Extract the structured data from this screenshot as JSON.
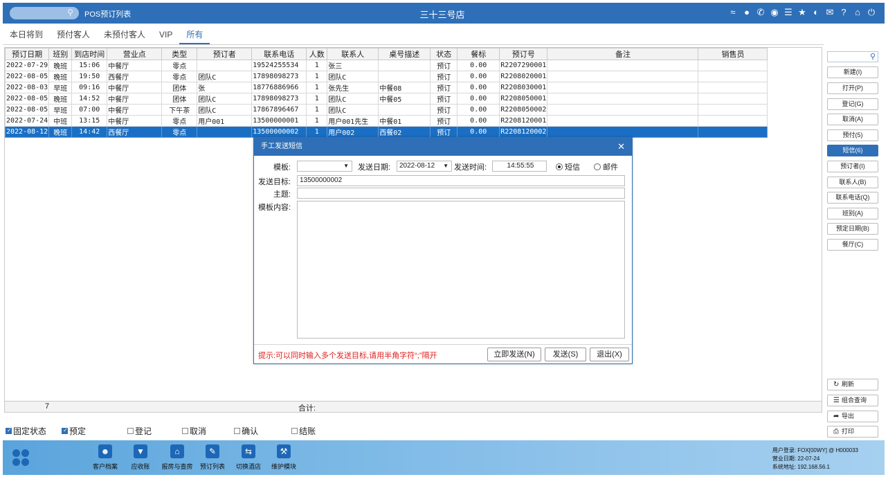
{
  "header": {
    "title": "POS预订列表",
    "store": "三十三号店",
    "icons": [
      "wifi-icon",
      "chat-icon",
      "phone-icon",
      "palette-icon",
      "menu-icon",
      "star-icon",
      "contrast-icon",
      "mail-icon",
      "help-icon",
      "home-icon",
      "power-icon"
    ]
  },
  "tabs": [
    {
      "label": "本日将到"
    },
    {
      "label": "预付客人"
    },
    {
      "label": "未预付客人"
    },
    {
      "label": "VIP"
    },
    {
      "label": "所有"
    }
  ],
  "grid": {
    "columns": [
      "预订日期",
      "班别",
      "到店时间",
      "营业点",
      "类型",
      "预订者",
      "联系电话",
      "人数",
      "联系人",
      "桌号描述",
      "状态",
      "餐标",
      "预订号",
      "备注",
      "销售员"
    ],
    "rows": [
      [
        "2022-07-29",
        "晚班",
        "15:06",
        "中餐厅",
        "零点",
        "",
        "19524255534",
        "1",
        "张三",
        "",
        "预订",
        "0.00",
        "R2207290001",
        "",
        ""
      ],
      [
        "2022-08-05",
        "晚班",
        "19:50",
        "西餐厅",
        "零点",
        "团队C",
        "17898098273",
        "1",
        "团队C",
        "",
        "预订",
        "0.00",
        "R2208020001",
        "",
        ""
      ],
      [
        "2022-08-03",
        "早班",
        "09:16",
        "中餐厅",
        "团体",
        "张",
        "18776886966",
        "1",
        "张先生",
        "中餐08",
        "预订",
        "0.00",
        "R2208030001",
        "",
        ""
      ],
      [
        "2022-08-05",
        "晚班",
        "14:52",
        "中餐厅",
        "团体",
        "团队C",
        "17898098273",
        "1",
        "团队C",
        "中餐05",
        "预订",
        "0.00",
        "R2208050001",
        "",
        ""
      ],
      [
        "2022-08-05",
        "早班",
        "07:00",
        "中餐厅",
        "下午茶",
        "团队C",
        "17867896467",
        "1",
        "团队C",
        "",
        "预订",
        "0.00",
        "R2208050002",
        "",
        ""
      ],
      [
        "2022-07-24",
        "中班",
        "13:15",
        "中餐厅",
        "零点",
        "用户001",
        "13500000001",
        "1",
        "用户001先生",
        "中餐01",
        "预订",
        "0.00",
        "R2208120001",
        "",
        ""
      ],
      [
        "2022-08-12",
        "晚班",
        "14:42",
        "西餐厅",
        "零点",
        "",
        "13500000002",
        "1",
        "用户002",
        "西餐02",
        "预订",
        "0.00",
        "R2208120002",
        "",
        ""
      ]
    ],
    "footer": {
      "count": "7",
      "sum_label": "合计:"
    }
  },
  "checks": [
    {
      "label": "固定状态",
      "checked": true
    },
    {
      "label": "预定",
      "checked": true
    },
    {
      "label": "登记",
      "checked": false
    },
    {
      "label": "取消",
      "checked": false
    },
    {
      "label": "确认",
      "checked": false
    },
    {
      "label": "结账",
      "checked": false
    }
  ],
  "right_panel": {
    "buttons": [
      "新建(I)",
      "打开(P)",
      "登记(G)",
      "取消(A)",
      "预付(5)",
      "短信(6)",
      "预订者(I)",
      "联系人(B)",
      "联系电话(Q)",
      "班别(A)",
      "预定日期(B)",
      "餐厅(C)"
    ],
    "actions": [
      {
        "label": "刷新",
        "icon": "refresh-icon"
      },
      {
        "label": "组合查询",
        "icon": "list-icon"
      },
      {
        "label": "导出",
        "icon": "export-icon"
      },
      {
        "label": "打印",
        "icon": "print-icon"
      }
    ]
  },
  "bottom_nav": [
    {
      "label": "客户档案",
      "icon": "customer-icon"
    },
    {
      "label": "应收账",
      "icon": "receivable-icon"
    },
    {
      "label": "报房与查房",
      "icon": "room-icon"
    },
    {
      "label": "预订列表",
      "icon": "booking-icon"
    },
    {
      "label": "切换酒店",
      "icon": "switch-icon"
    },
    {
      "label": "维护模块",
      "icon": "wrench-icon"
    }
  ],
  "sysinfo": {
    "user": "用户登录: FOX[00WY] @ H000033",
    "business_date": "营业日期: 22-07-24",
    "address": "系统地址: 192.168.56.1"
  },
  "dialog": {
    "title": "手工发送短信",
    "template_label": "模板:",
    "template_value": "",
    "send_date_label": "发送日期:",
    "send_date_value": "2022-08-12",
    "send_time_label": "发送时间:",
    "send_time_value": "14:55:55",
    "radio_sms": "短信",
    "radio_email": "邮件",
    "target_label": "发送目标:",
    "target_value": "13500000002",
    "subject_label": "主题:",
    "subject_value": "",
    "content_label": "模板内容:",
    "content_value": "",
    "hint": "提示:可以同时输入多个发送目标,请用半角字符“;”隔开",
    "btn_send_now": "立即发送(N)",
    "btn_send": "发送(S)",
    "btn_exit": "退出(X)"
  },
  "colors": {
    "accent": "#2f6fb7",
    "selected_row": "#1a6fc4",
    "hint": "#e02020"
  }
}
